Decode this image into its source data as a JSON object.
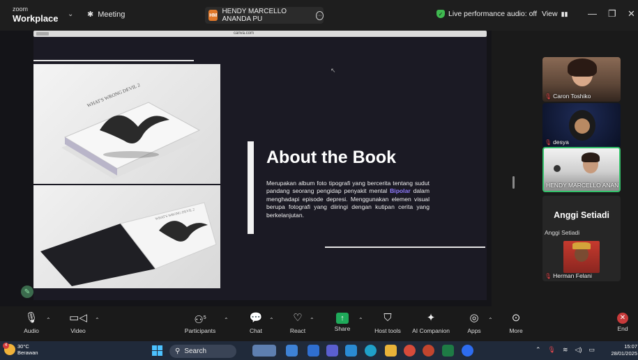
{
  "titlebar": {
    "logo_small": "zoom",
    "logo_big": "Workplace",
    "meeting_label": "Meeting",
    "sharer_initials": "HM",
    "sharer_name": "HENDY MARCELLO ANANDA PU",
    "perf_audio": "Live performance audio: off",
    "view_label": "View"
  },
  "browser": {
    "url": "canva.com"
  },
  "slide": {
    "title": "About the Book",
    "desc_part1": "Merupakan album foto tipografi yang bercerita tentang sudut pandang seorang pengidap penyakit mental ",
    "desc_highlight": "Bipolar",
    "desc_part2": " dalam menghadapi episode depresi. Menggunakan elemen visual berupa fotografi yang diiringi dengan kutipan cerita yang berkelanjutan.",
    "book_title": "WHAT'S WRONG DEVIL 2"
  },
  "participants": {
    "tiles": [
      {
        "name": "Caron Toshiko"
      },
      {
        "name": "desya"
      },
      {
        "name": "HENDY MARCELLO ANAN"
      }
    ],
    "bigname": "Anggi Setiadi",
    "smallname": "Anggi Setiadi",
    "last_tile": "Herman Felani"
  },
  "toolbar": {
    "audio": "Audio",
    "video": "Video",
    "participants": "Participants",
    "participants_count": "5",
    "chat": "Chat",
    "react": "React",
    "share": "Share",
    "host_tools": "Host tools",
    "ai_companion": "AI Companion",
    "apps": "Apps",
    "more": "More",
    "end": "End"
  },
  "taskbar": {
    "temp": "30°C",
    "weather": "Berawan",
    "notif_count": "4",
    "search": "Search",
    "time": "15:07",
    "date": "28/01/2025"
  },
  "colors": {
    "accent_green": "#34c26b",
    "highlight_purple": "#8f7bff",
    "end_red": "#c83a3a"
  }
}
